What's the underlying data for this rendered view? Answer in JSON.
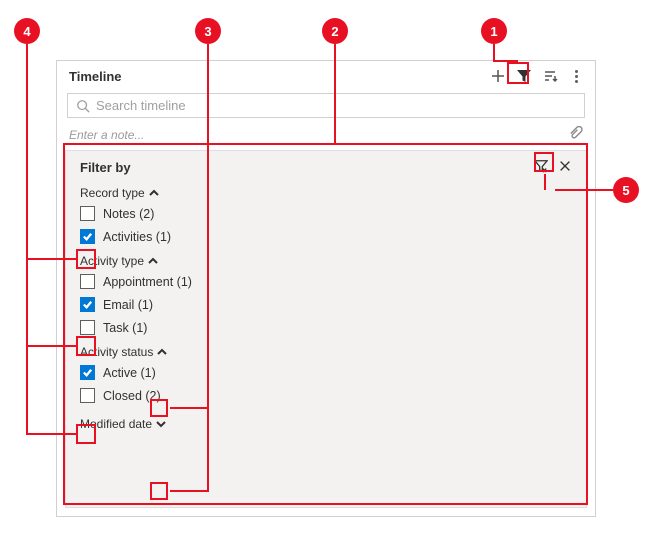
{
  "header": {
    "title": "Timeline"
  },
  "search": {
    "placeholder": "Search timeline"
  },
  "noteRow": {
    "placeholder": "Enter a note..."
  },
  "panel": {
    "title": "Filter by",
    "sections": {
      "recordType": {
        "label": "Record type",
        "expanded": true,
        "options": [
          {
            "label": "Notes (2)",
            "checked": false
          },
          {
            "label": "Activities (1)",
            "checked": true
          }
        ]
      },
      "activityType": {
        "label": "Activity type",
        "expanded": true,
        "options": [
          {
            "label": "Appointment (1)",
            "checked": false
          },
          {
            "label": "Email (1)",
            "checked": true
          },
          {
            "label": "Task (1)",
            "checked": false
          }
        ]
      },
      "activityStatus": {
        "label": "Activity status",
        "expanded": true,
        "options": [
          {
            "label": "Active (1)",
            "checked": true
          },
          {
            "label": "Closed (2)",
            "checked": false
          }
        ]
      },
      "modifiedDate": {
        "label": "Modified date",
        "expanded": false
      }
    }
  },
  "callouts": {
    "c1": "1",
    "c2": "2",
    "c3": "3",
    "c4": "4",
    "c5": "5"
  }
}
